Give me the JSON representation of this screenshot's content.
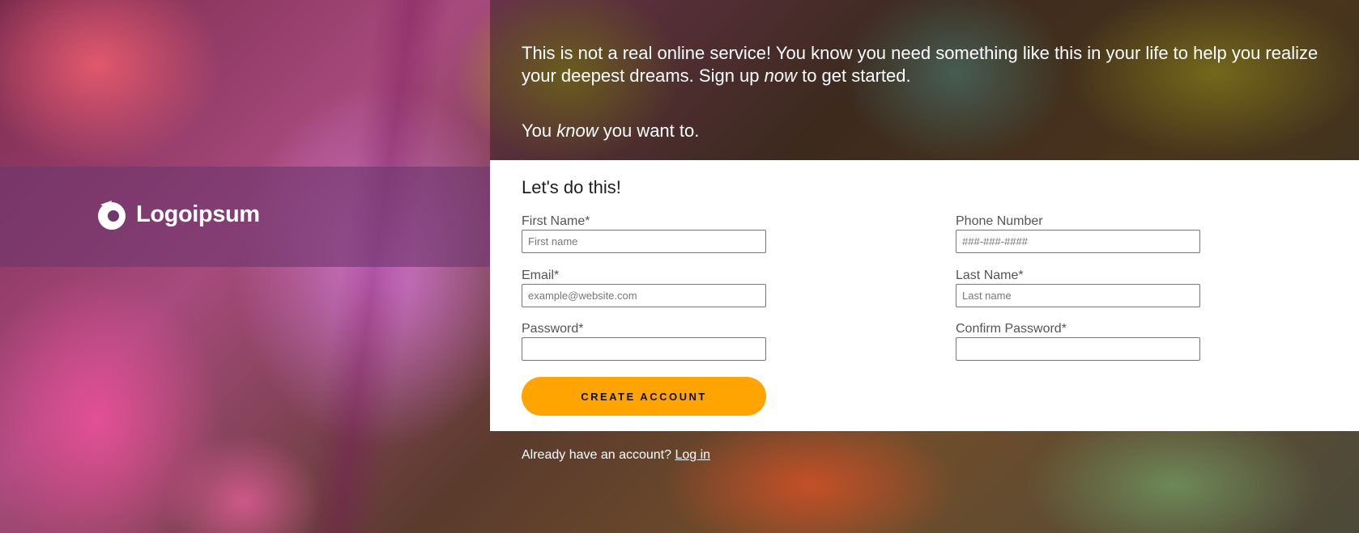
{
  "brand": {
    "name": "Logoipsum",
    "icon": "logoipsum-mark-icon"
  },
  "intro": {
    "line1": "This is not a real online service! You know you need something like this in your life to help you realize",
    "line2_before": "your deepest dreams. Sign up ",
    "line2_emph": "now",
    "line2_after": " to get started.",
    "know_before": "You ",
    "know_emph": "know",
    "know_after": " you want to."
  },
  "form": {
    "title": "Let's do this!",
    "fields": {
      "first_name": {
        "label": "First Name*",
        "placeholder": "First name",
        "value": ""
      },
      "email": {
        "label": "Email*",
        "placeholder": "example@website.com",
        "value": ""
      },
      "password": {
        "label": "Password*",
        "placeholder": "",
        "value": ""
      },
      "phone": {
        "label": "Phone Number",
        "placeholder": "###-###-####",
        "value": ""
      },
      "last_name": {
        "label": "Last Name*",
        "placeholder": "Last name",
        "value": ""
      },
      "confirm_password": {
        "label": "Confirm Password*",
        "placeholder": "",
        "value": ""
      }
    },
    "submit_label": "Create Account"
  },
  "footer": {
    "prompt": "Already have an account? ",
    "login_link": "Log in"
  },
  "colors": {
    "button": "#ffa400",
    "band": "#6e376e",
    "text_on_image": "#ffffff"
  }
}
